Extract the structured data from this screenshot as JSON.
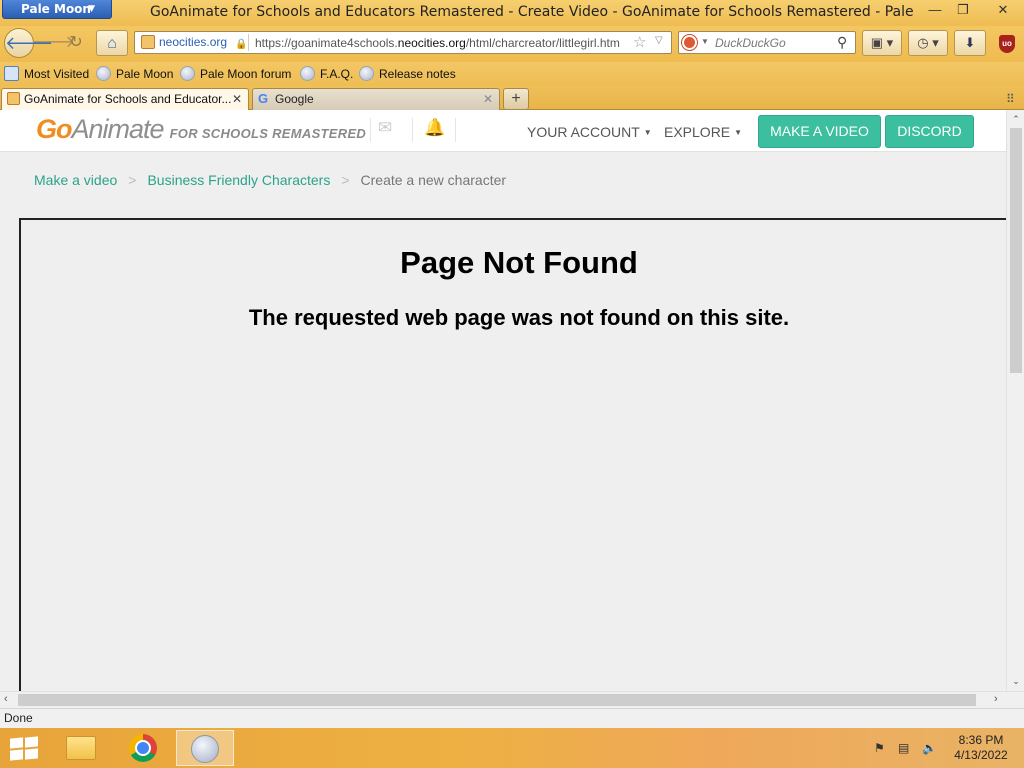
{
  "window": {
    "app_menu": "Pale Moon",
    "title": "GoAnimate for Schools and Educators Remastered - Create Video - GoAnimate for Schools Remastered - Pale",
    "minimize": "—",
    "maximize": "❐",
    "close": "✕"
  },
  "nav": {
    "back": "🡐",
    "forward": "🡒",
    "reload": "↻",
    "home": "⌂",
    "site_identity": "neocities.org",
    "url_prefix": "https://goanimate4schools.",
    "url_domain": "neocities.org",
    "url_path": "/html/charcreator/littlegirl.htm",
    "search_placeholder": "DuckDuckGo"
  },
  "bookmarks": [
    "Most Visited",
    "Pale Moon",
    "Pale Moon forum",
    "F.A.Q.",
    "Release notes"
  ],
  "tabs": [
    {
      "label": "GoAnimate for Schools and Educator...",
      "close": "✕"
    },
    {
      "label": "Google",
      "close": "✕",
      "icon_letter": "G"
    }
  ],
  "new_tab": "+",
  "site": {
    "logo_go": "Go",
    "logo_animate": "Animate",
    "logo_sub": "FOR SCHOOLS REMASTERED",
    "nav_account": "YOUR ACCOUNT",
    "nav_explore": "EXPLORE",
    "btn_make_video": "MAKE A VIDEO",
    "btn_discord": "DISCORD",
    "accent_color": "#3cbf9f",
    "logo_color": "#f08d1e"
  },
  "breadcrumb": {
    "items": [
      "Make a video",
      "Business Friendly Characters"
    ],
    "current": "Create a new character",
    "separator": ">"
  },
  "error": {
    "title": "Page Not Found",
    "message": "The requested web page was not found on this site."
  },
  "status": "Done",
  "clock": {
    "time": "8:36 PM",
    "date": "4/13/2022"
  }
}
